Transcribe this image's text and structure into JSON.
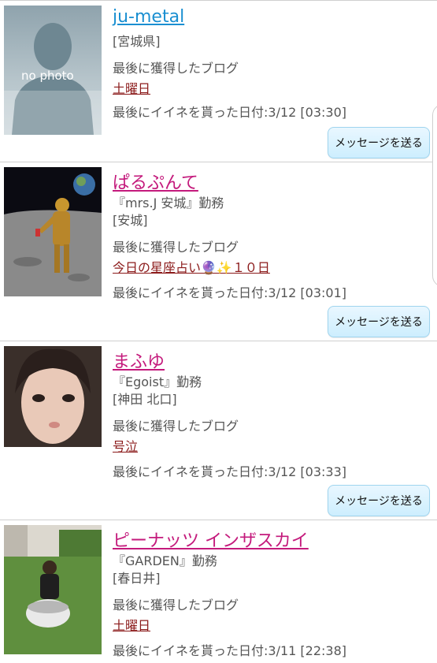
{
  "list": [
    {
      "name": "ju-metal",
      "name_color": "#1a8fd1",
      "workplace": "",
      "area": "[宮城県]",
      "blog_label": "最後に獲得したブログ",
      "blog_title": "土曜日",
      "last_like": "最後にイイネを貰った日付:3/12 [03:30]",
      "button_label": "メッセージを送る",
      "photo_text": "no photo"
    },
    {
      "name": "ぱるぷんて",
      "name_color": "#c41a7c",
      "workplace": "『mrs.J 安城』勤務",
      "area": "[安城]",
      "blog_label": "最後に獲得したブログ",
      "blog_title": "今日の星座占い🔮✨１０日",
      "last_like": "最後にイイネを貰った日付:3/12 [03:01]",
      "button_label": "メッセージを送る"
    },
    {
      "name": "まふゆ",
      "name_color": "#c41a7c",
      "workplace": "『Egoist』勤務",
      "area": "[神田 北口]",
      "blog_label": "最後に獲得したブログ",
      "blog_title": "号泣",
      "last_like": "最後にイイネを貰った日付:3/12 [03:33]",
      "button_label": "メッセージを送る"
    },
    {
      "name": "ピーナッツ インザスカイ",
      "name_color": "#c41a7c",
      "workplace": "『GARDEN』勤務",
      "area": "[春日井]",
      "blog_label": "最後に獲得したブログ",
      "blog_title": "土曜日",
      "last_like": "最後にイイネを貰った日付:3/11 [22:38]"
    }
  ]
}
